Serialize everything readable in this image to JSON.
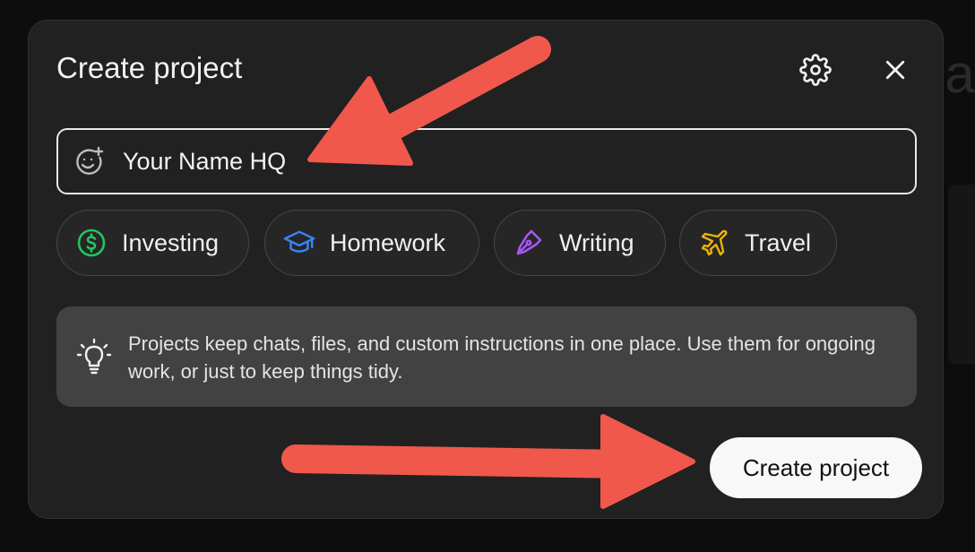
{
  "dialog": {
    "title": "Create project",
    "settings_icon": "gear-icon",
    "close_icon": "close-icon"
  },
  "name_field": {
    "value": "Your Name HQ",
    "icon": "add-emoji-icon"
  },
  "chips": [
    {
      "label": "Investing",
      "icon": "dollar-circle-icon",
      "color": "#22c55e"
    },
    {
      "label": "Homework",
      "icon": "graduation-cap-icon",
      "color": "#3b82f6"
    },
    {
      "label": "Writing",
      "icon": "pen-nib-icon",
      "color": "#a855f7"
    },
    {
      "label": "Travel",
      "icon": "airplane-icon",
      "color": "#eab308"
    }
  ],
  "info": {
    "text": "Projects keep chats, files, and custom instructions in one place. Use them for ongoing work, or just to keep things tidy.",
    "icon": "lightbulb-icon"
  },
  "create_button": {
    "label": "Create project"
  },
  "annotation_color": "#f0584c"
}
